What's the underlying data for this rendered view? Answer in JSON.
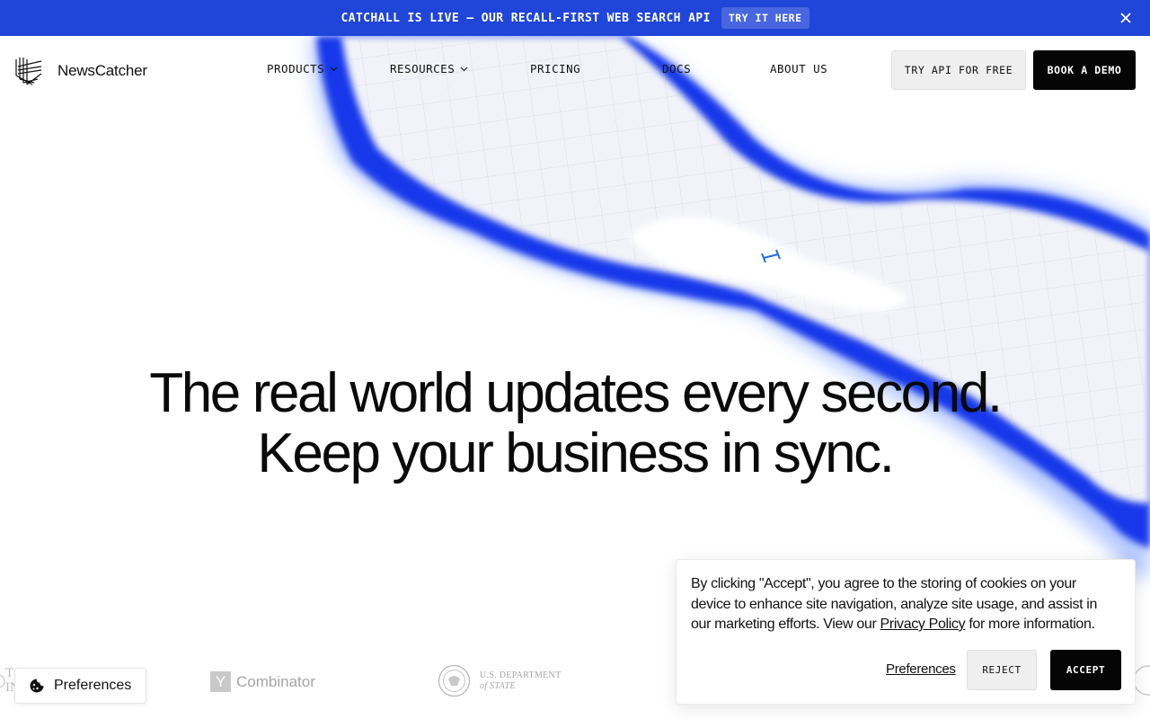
{
  "announcement": {
    "text": "CATCHALL IS LIVE — OUR RECALL-FIRST WEB SEARCH API",
    "button_label": "TRY IT HERE",
    "close_icon": "close-icon"
  },
  "header": {
    "brand": "NewsCatcher",
    "nav": [
      {
        "label": "PRODUCTS",
        "has_dropdown": true
      },
      {
        "label": "RESOURCES",
        "has_dropdown": true
      },
      {
        "label": "PRICING",
        "has_dropdown": false
      },
      {
        "label": "DOCS",
        "has_dropdown": false
      },
      {
        "label": "ABOUT US",
        "has_dropdown": false
      }
    ],
    "try_button": "TRY API FOR FREE",
    "demo_button": "BOOK A DEMO"
  },
  "hero": {
    "line1": "The real world updates every second.",
    "line2": "Keep your business in sync."
  },
  "logos": {
    "partial": "T\nIN",
    "yc_mark": "Y",
    "yc_name": "Combinator",
    "state_line1": "U.S. DEPARTMENT",
    "state_line2": "of STATE"
  },
  "preferences_pill": {
    "label": "Preferences",
    "icon": "cookie-icon"
  },
  "cookie_banner": {
    "message_before": "By clicking \"Accept\", you agree to the storing of cookies on your device to enhance site navigation, analyze site usage, and assist in our marketing efforts. View our ",
    "link": "Privacy Policy",
    "message_after": " for more information.",
    "preferences": "Preferences",
    "reject": "REJECT",
    "accept": "ACCEPT"
  },
  "colors": {
    "announcement_bg": "#1f45d9",
    "accent_blue": "#1f3fe0",
    "primary_button": "#050505",
    "secondary_button": "#efefef"
  }
}
